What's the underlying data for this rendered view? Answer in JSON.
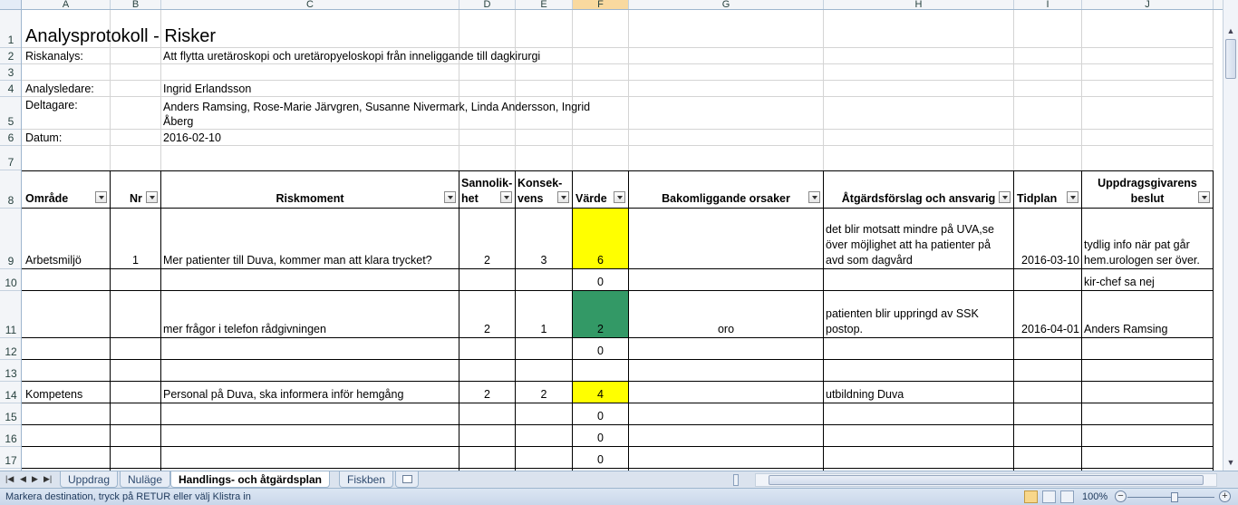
{
  "sheet": {
    "columns": [
      "A",
      "B",
      "C",
      "D",
      "E",
      "F",
      "G",
      "H",
      "I",
      "J"
    ],
    "selected_column": "F",
    "rows": [
      "1",
      "2",
      "3",
      "4",
      "5",
      "6",
      "7",
      "8",
      "9",
      "10",
      "11",
      "12",
      "13",
      "14",
      "15",
      "16",
      "17"
    ],
    "title": "Analysprotokoll - Risker",
    "meta": {
      "riskanalys_label": "Riskanalys:",
      "riskanalys_value": "Att flytta uretäroskopi och uretäropyeloskopi från inneliggande till dagkirurgi",
      "analysledare_label": "Analysledare:",
      "analysledare_value": "Ingrid Erlandsson",
      "deltagare_label": "Deltagare:",
      "deltagare_line1": "Anders Ramsing, Rose-Marie Järvgren, Susanne Nivermark, Linda Andersson, Ingrid",
      "deltagare_line2": "Åberg",
      "datum_label": "Datum:",
      "datum_value": "2016-02-10"
    },
    "headers": {
      "omrade": "Område",
      "nr": "Nr",
      "riskmoment": "Riskmoment",
      "sannolikhet_1": "Sannolik-",
      "sannolikhet_2": "het",
      "konsekvens_1": "Konsek-",
      "konsekvens_2": "vens",
      "varde": "Värde",
      "orsaker": "Bakomliggande orsaker",
      "atgard": "Åtgärdsförslag och ansvarig",
      "tidplan": "Tidplan",
      "beslut_1": "Uppdragsgivarens",
      "beslut_2": "beslut"
    },
    "r9": {
      "omrade": "Arbetsmiljö",
      "nr": "1",
      "riskmoment": "Mer patienter till Duva, kommer man att klara trycket?",
      "sannolikhet": "2",
      "konsekvens": "3",
      "varde": "6",
      "atgard_1": "det blir motsatt mindre på UVA,se",
      "atgard_2": "över möjlighet att ha patienter på",
      "atgard_3": "avd som dagvård",
      "tidplan": "2016-03-10",
      "beslut_1": "tydlig info när pat går",
      "beslut_2": "hem.urologen ser över."
    },
    "r10": {
      "varde": "0",
      "beslut": "kir-chef sa nej"
    },
    "r11": {
      "riskmoment": "mer frågor i telefon rådgivningen",
      "sannolikhet": "2",
      "konsekvens": "1",
      "varde": "2",
      "orsaker": "oro",
      "atgard_1": "patienten blir uppringd av SSK",
      "atgard_2": "postop.",
      "tidplan": "2016-04-01",
      "beslut": "Anders Ramsing"
    },
    "r12": {
      "varde": "0"
    },
    "r14": {
      "omrade": "Kompetens",
      "riskmoment": "Personal på Duva, ska informera inför hemgång",
      "sannolikhet": "2",
      "konsekvens": "2",
      "varde": "4",
      "atgard": "utbildning Duva"
    },
    "r15": {
      "varde": "0"
    },
    "r16": {
      "varde": "0"
    },
    "r17": {
      "varde": "0"
    }
  },
  "colors": {
    "yellow": "#ffff00",
    "green": "#339966"
  },
  "tabs": [
    "Uppdrag",
    "Nuläge",
    "Handlings- och åtgärdsplan",
    "Fiskben"
  ],
  "active_tab": "Handlings- och åtgärdsplan",
  "status": {
    "message": "Markera destination, tryck på RETUR eller välj Klistra in",
    "zoom": "100%"
  }
}
